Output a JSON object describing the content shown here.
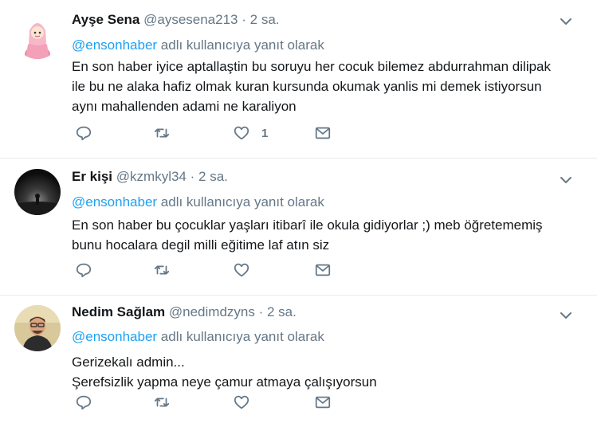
{
  "tweets": [
    {
      "name": "Ayşe Sena",
      "handle": "@aysesena213",
      "separator": "·",
      "time": "2 sa.",
      "reply_mention": "@ensonhaber",
      "reply_suffix": " adlı kullanıcıya yanıt olarak",
      "text": "En son haber iyice aptallaştin bu soruyu her cocuk bilemez abdurrahman dilipak\nile bu ne alaka hafiz olmak kuran kursunda okumak yanlis mi demek istiyorsun\naynı mahallenden adami ne karaliyon",
      "like_count": "1"
    },
    {
      "name": "Er kişi",
      "handle": "@kzmkyl34",
      "separator": "·",
      "time": "2 sa.",
      "reply_mention": "@ensonhaber",
      "reply_suffix": " adlı kullanıcıya yanıt olarak",
      "text": "En son haber bu çocuklar yaşları itibarî ile okula gidiyorlar ;) meb öğretememiş\nbunu hocalara degil milli eğitime laf atın siz",
      "like_count": ""
    },
    {
      "name": "Nedim Sağlam",
      "handle": "@nedimdzyns",
      "separator": "·",
      "time": "2 sa.",
      "reply_mention": "@ensonhaber",
      "reply_suffix": " adlı kullanıcıya yanıt olarak",
      "text": "Gerizekalı admin...\nŞerefsizlik yapma neye çamur atmaya çalışıyorsun",
      "like_count": ""
    }
  ],
  "icons": {
    "reply": "reply-icon",
    "retweet": "retweet-icon",
    "like": "heart-icon",
    "message": "envelope-icon",
    "more": "chevron-down-icon"
  },
  "colors": {
    "action_gray": "#657786",
    "link_blue": "#1da1f2",
    "divider": "#e6ecf0"
  }
}
